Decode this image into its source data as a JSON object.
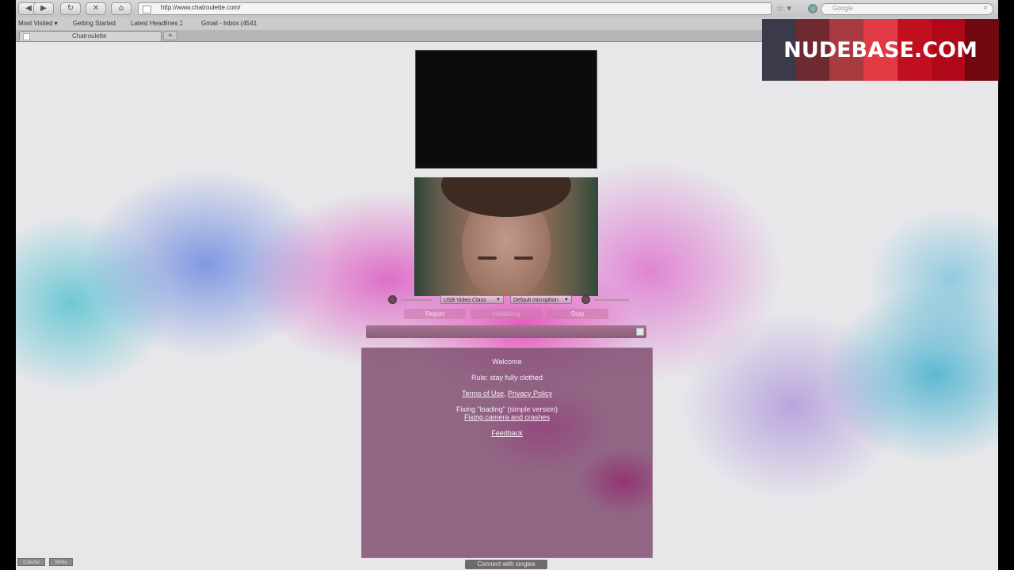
{
  "browser": {
    "nav_glyphs": [
      "◀",
      "▶",
      "↻",
      "✕",
      "⌂"
    ],
    "url": "http://www.chatroulette.com/",
    "search_placeholder": "Google",
    "bookmarks": [
      "Most Visited ▾",
      "Getting Started",
      "Latest Headlines ℷ",
      "Gmail - Inbox (4541"
    ],
    "tab_title": "Chatroulette",
    "new_tab_glyph": "+"
  },
  "page": {
    "camera_select": "USB Video Class",
    "mic_select": "Default microphon",
    "buttons": {
      "report": "Report",
      "initializing": "Initializing",
      "stop": "Stop"
    },
    "panel": {
      "welcome": "Welcome",
      "rule": "Rule: stay fully clothed",
      "terms": "Terms of Use",
      "comma": ",",
      "privacy": "Privacy Policy",
      "fix_loading": "Fixing \"loading\" (simple version)",
      "fix_camera": "Fixing camera and crashes",
      "feedback": "Feedback"
    },
    "connect": "Connect with singles",
    "themes": [
      "Colorful",
      "White"
    ]
  },
  "watermark": {
    "text": "NUDEBASE.COM",
    "strip_colors": [
      "#3a3a4a",
      "#6e2a30",
      "#a83a40",
      "#e23a44",
      "#c01020",
      "#b00818",
      "#700810"
    ]
  }
}
